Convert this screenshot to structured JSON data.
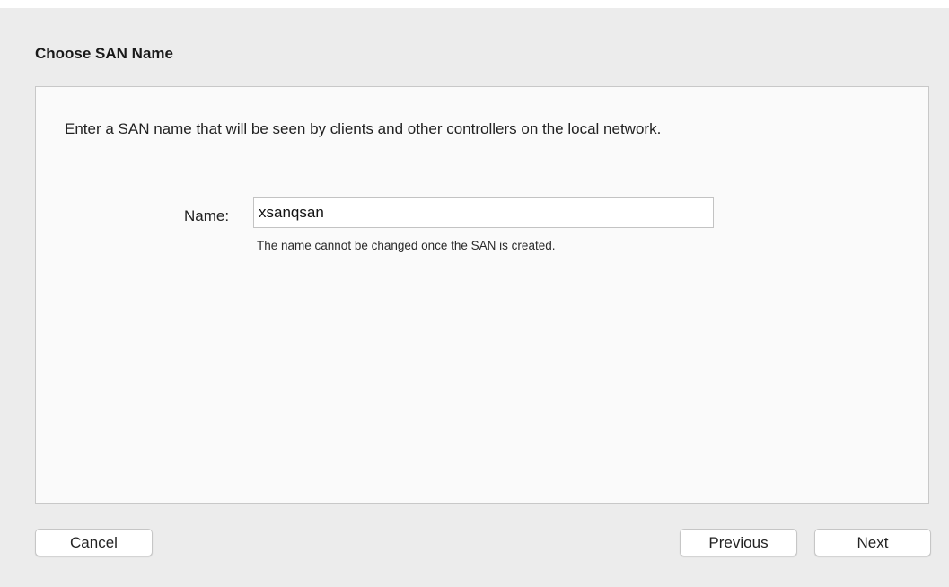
{
  "dialog": {
    "title": "Choose SAN Name",
    "intro": "Enter a SAN name that will be seen by clients and other controllers on the local network.",
    "name_field": {
      "label": "Name:",
      "value": "xsanqsan",
      "hint": "The name cannot be changed once the SAN is created."
    }
  },
  "buttons": {
    "cancel": "Cancel",
    "previous": "Previous",
    "next": "Next"
  },
  "colors": {
    "background": "#ececec",
    "panel": "#fafafa",
    "border": "#c8c8c8"
  }
}
